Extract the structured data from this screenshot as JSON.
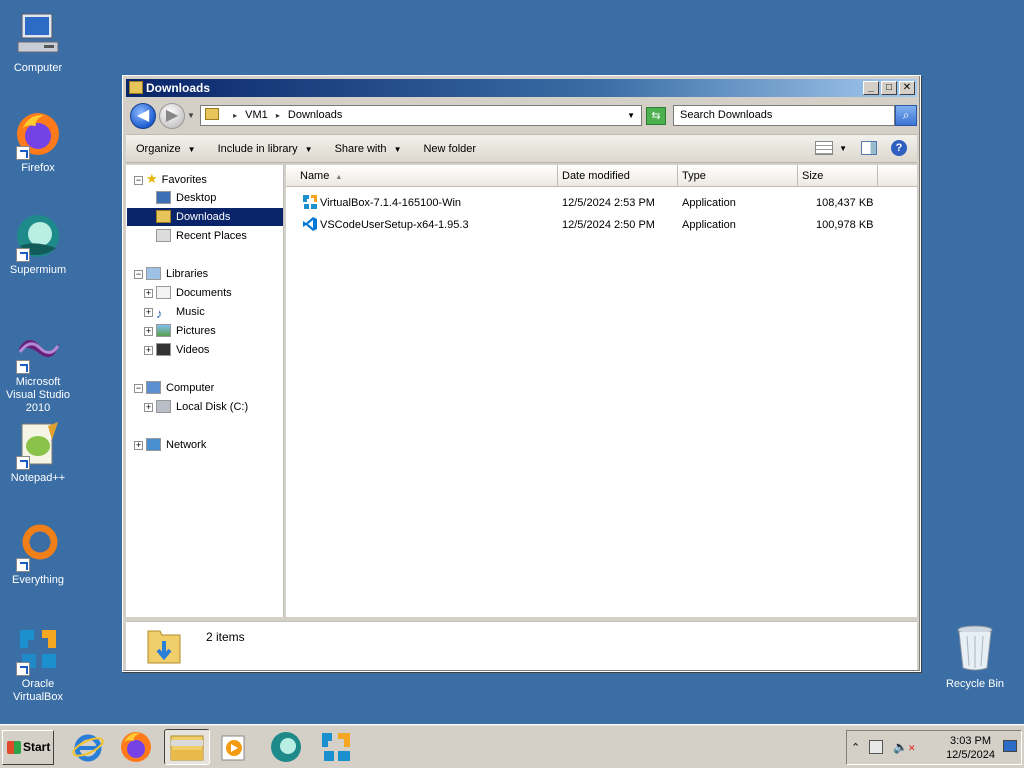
{
  "desktop": {
    "icons": [
      {
        "label": "Computer"
      },
      {
        "label": "Firefox"
      },
      {
        "label": "Supermium"
      },
      {
        "label": "Microsoft Visual Studio 2010"
      },
      {
        "label": "Notepad++"
      },
      {
        "label": "Everything"
      },
      {
        "label": "Oracle VirtualBox"
      }
    ],
    "recycle_bin": "Recycle Bin"
  },
  "window": {
    "title": "Downloads",
    "breadcrumb": [
      "VM1",
      "Downloads"
    ],
    "search_placeholder": "Search Downloads",
    "toolbar": {
      "organize": "Organize",
      "include_in_library": "Include in library",
      "share_with": "Share with",
      "new_folder": "New folder"
    },
    "nav": {
      "favorites": "Favorites",
      "desktop": "Desktop",
      "downloads": "Downloads",
      "recent_places": "Recent Places",
      "libraries": "Libraries",
      "documents": "Documents",
      "music": "Music",
      "pictures": "Pictures",
      "videos": "Videos",
      "computer": "Computer",
      "local_disk": "Local Disk (C:)",
      "network": "Network"
    },
    "columns": {
      "name": "Name",
      "date": "Date modified",
      "type": "Type",
      "size": "Size"
    },
    "files": [
      {
        "name": "VirtualBox-7.1.4-165100-Win",
        "date": "12/5/2024 2:53 PM",
        "type": "Application",
        "size": "108,437 KB",
        "icon": "virtualbox-icon"
      },
      {
        "name": "VSCodeUserSetup-x64-1.95.3",
        "date": "12/5/2024 2:50 PM",
        "type": "Application",
        "size": "100,978 KB",
        "icon": "vscode-icon"
      }
    ],
    "status": {
      "count": "2 items"
    }
  },
  "taskbar": {
    "start": "Start",
    "clock_time": "3:03 PM",
    "clock_date": "12/5/2024"
  },
  "colors": {
    "desktop": "#3a6ea5",
    "selection": "#0a246a"
  }
}
